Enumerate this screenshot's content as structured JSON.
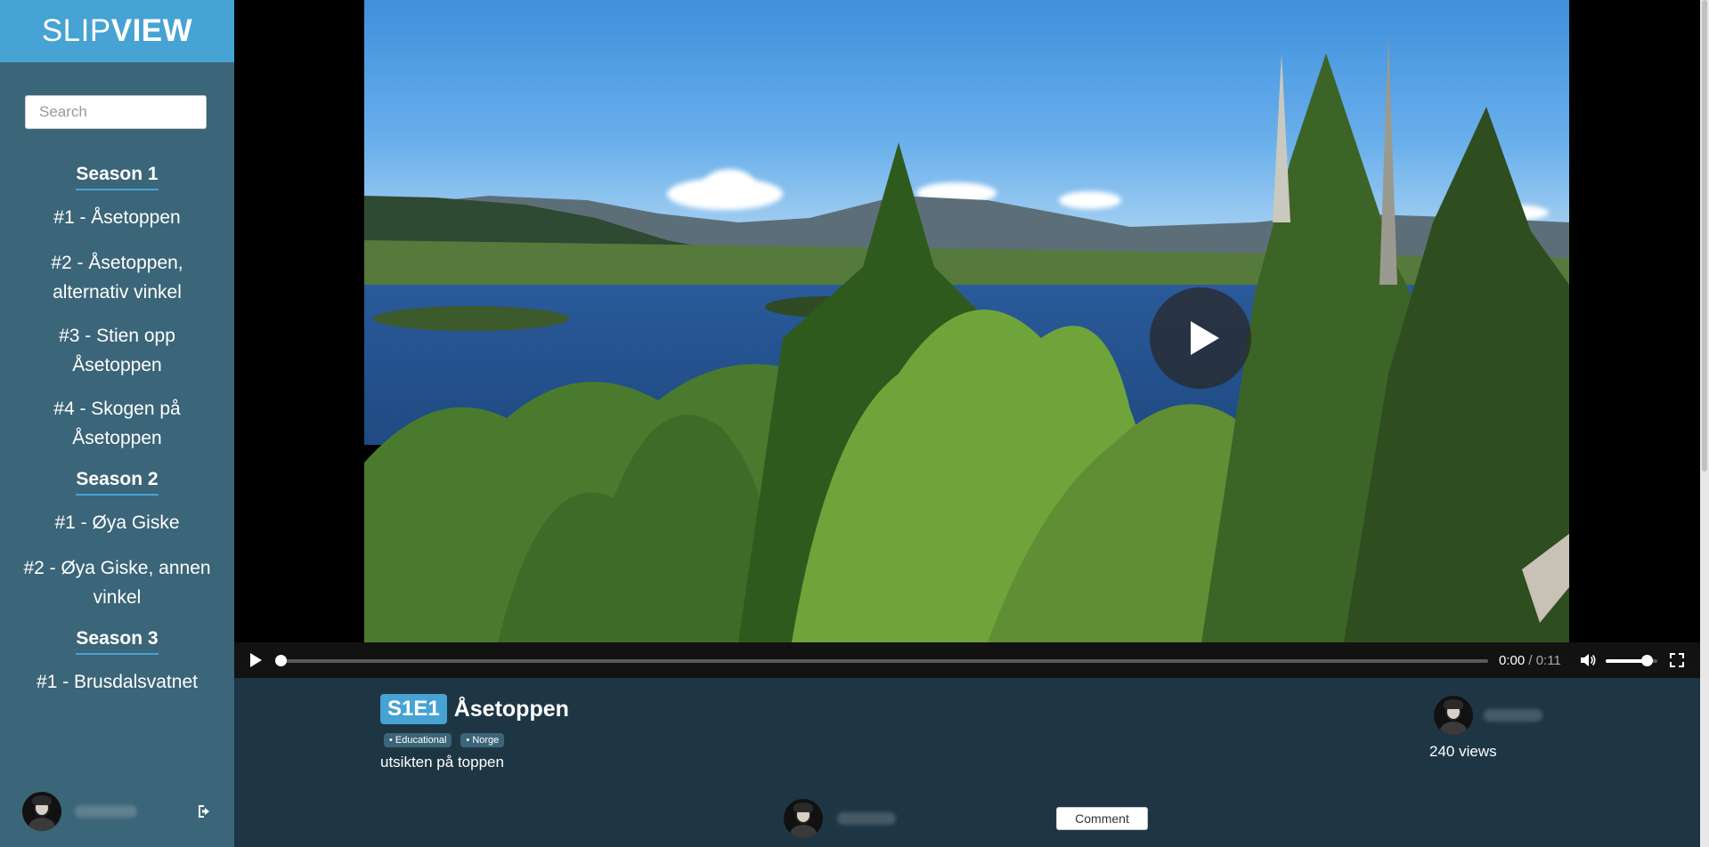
{
  "app": {
    "logo_light": "SLIP",
    "logo_bold": "VIEW"
  },
  "sidebar": {
    "search_placeholder": "Search",
    "seasons": [
      {
        "label": "Season 1",
        "episodes": [
          "#1 - Åsetoppen",
          "#2 - Åsetoppen, alternativ vinkel",
          "#3 - Stien opp Åsetoppen",
          "#4 - Skogen på Åsetoppen"
        ]
      },
      {
        "label": "Season 2",
        "episodes": [
          "#1 - Øya Giske",
          "#2 - Øya Giske, annen vinkel"
        ]
      },
      {
        "label": "Season 3",
        "episodes": [
          "#1 - Brusdalsvatnet"
        ]
      }
    ],
    "user_icon": "avatar",
    "logout_icon": "sign-out-icon"
  },
  "player": {
    "current_time": "0:00",
    "separator": " / ",
    "duration": "0:11",
    "progress": 0.0,
    "volume": 0.8,
    "big_play_icon": "play-icon",
    "fullscreen_icon": "fullscreen-icon",
    "volume_icon": "volume-icon"
  },
  "episode": {
    "code": "S1E1",
    "title": "Åsetoppen",
    "tags": [
      "• Educational",
      "• Norge"
    ],
    "description": "utsikten på toppen",
    "views": "240 views"
  },
  "comment": {
    "button_label": "Comment"
  },
  "colors": {
    "accent": "#46a3d3",
    "sidebar_bg": "#3b6578",
    "page_bg": "#1e3644"
  }
}
